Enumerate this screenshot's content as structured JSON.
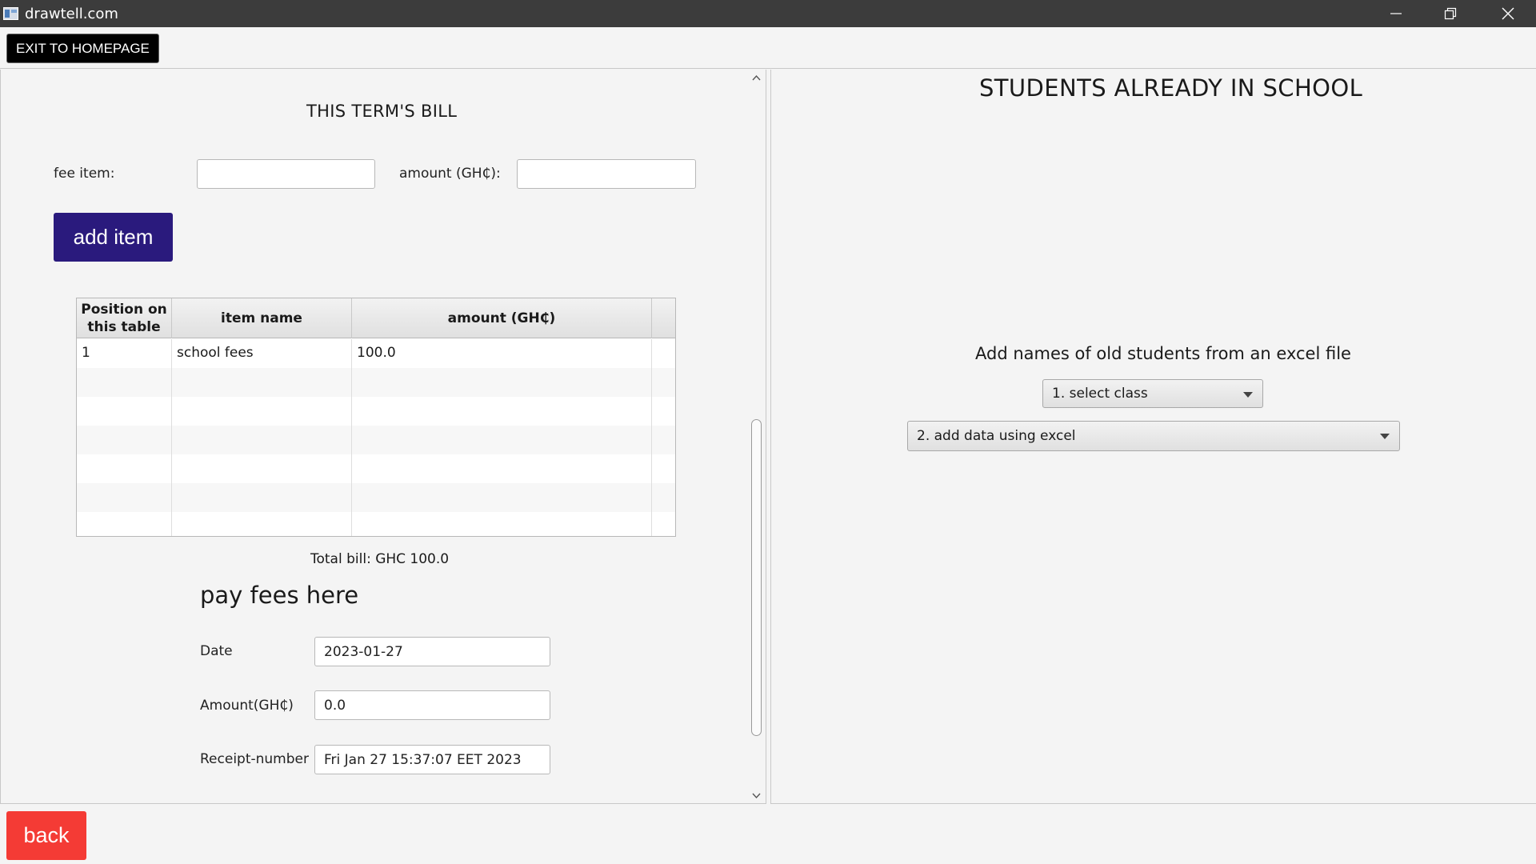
{
  "window": {
    "title": "drawtell.com",
    "controls": [
      "minimize-icon",
      "restore-icon",
      "close-icon"
    ]
  },
  "toolbar": {
    "exit_label": "EXIT TO HOMEPAGE"
  },
  "bill": {
    "title": "THIS TERM'S BILL",
    "fee_item_label": "fee item:",
    "fee_item_value": "",
    "amount_label": "amount (GH₵):",
    "amount_value": "",
    "add_button_label": "add item",
    "table": {
      "headers": [
        "Position on this table",
        "item name",
        "amount (GH₵)"
      ],
      "rows": [
        [
          "1",
          "school fees",
          "100.0"
        ]
      ]
    },
    "total_text": "Total bill: GHC 100.0"
  },
  "payment": {
    "heading": "pay fees here",
    "date_label": "Date",
    "date_value": "2023-01-27",
    "amount_label": "Amount(GH₵)",
    "amount_value": "0.0",
    "receipt_label": "Receipt-number",
    "receipt_value": "Fri Jan 27 15:37:07 EET 2023"
  },
  "students": {
    "title": "STUDENTS ALREADY IN SCHOOL",
    "subtitle": "Add names of old students from an excel file",
    "class_select": "1. select class",
    "excel_select": "2. add data using excel"
  },
  "footer": {
    "back_label": "back"
  },
  "colors": {
    "title_bar": "#3c3c3c",
    "add_button": "#2a1a7d",
    "back_button": "#f43b35",
    "exit_button": "#000000"
  }
}
